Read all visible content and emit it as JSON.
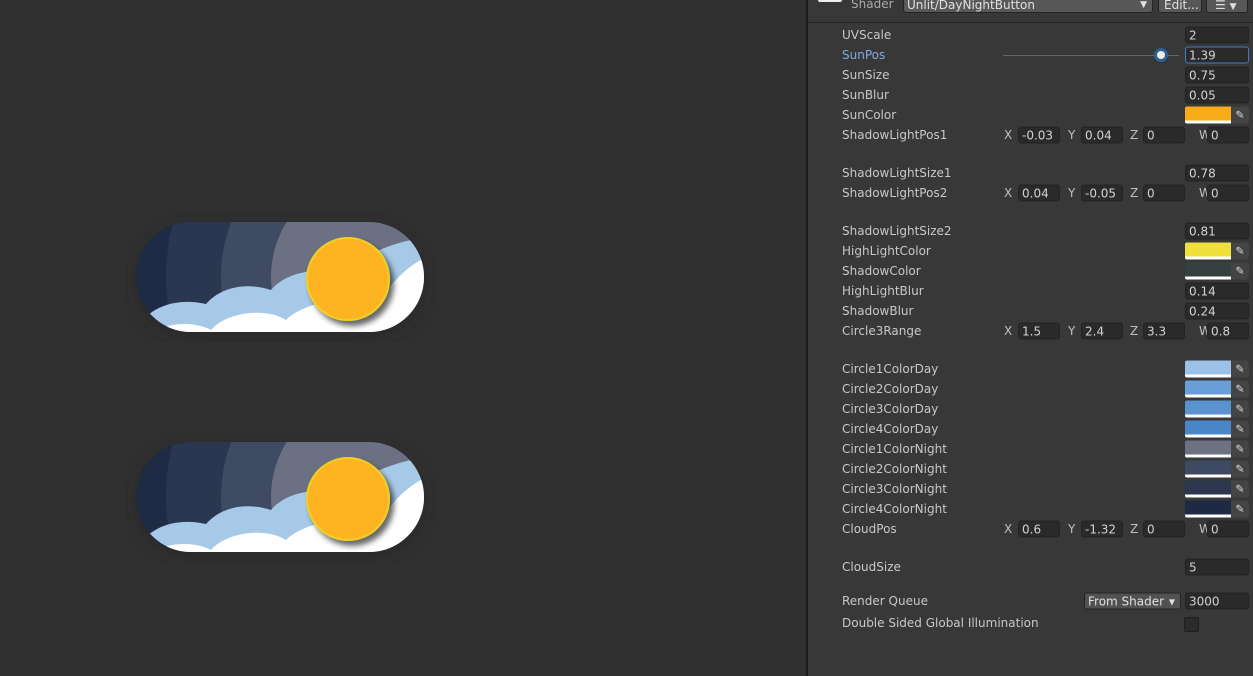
{
  "header": {
    "shader_label": "Shader",
    "shader_value": "Unlit/DayNightButton",
    "edit_label": "Edit...",
    "menu_icon": "list-icon"
  },
  "slider": {
    "value": 1.39,
    "min": 0,
    "max": 1.5
  },
  "rows": [
    {
      "label": "UVScale",
      "type": "float",
      "value": "2"
    },
    {
      "label": "SunPos",
      "type": "slider",
      "value": "1.39",
      "active": true
    },
    {
      "label": "SunSize",
      "type": "float",
      "value": "0.75"
    },
    {
      "label": "SunBlur",
      "type": "float",
      "value": "0.05"
    },
    {
      "label": "SunColor",
      "type": "color",
      "color": "#f8ac18"
    },
    {
      "label": "ShadowLightPos1",
      "type": "vector",
      "x": "-0.03",
      "y": "0.04",
      "z": "0",
      "w": "0"
    },
    {
      "label": "ShadowLightSize1",
      "type": "float",
      "value": "0.78"
    },
    {
      "label": "ShadowLightPos2",
      "type": "vector",
      "x": "0.04",
      "y": "-0.05",
      "z": "0",
      "w": "0"
    },
    {
      "label": "ShadowLightSize2",
      "type": "float",
      "value": "0.81"
    },
    {
      "label": "HighLightColor",
      "type": "color",
      "color": "#f0e03c"
    },
    {
      "label": "ShadowColor",
      "type": "color",
      "color": "#36403f"
    },
    {
      "label": "HighLightBlur",
      "type": "float",
      "value": "0.14"
    },
    {
      "label": "ShadowBlur",
      "type": "float",
      "value": "0.24"
    },
    {
      "label": "Circle3Range",
      "type": "vector",
      "x": "1.5",
      "y": "2.4",
      "z": "3.3",
      "w": "0.8"
    },
    {
      "label": "Circle1ColorDay",
      "type": "color",
      "color": "#9cc0e6"
    },
    {
      "label": "Circle2ColorDay",
      "type": "color",
      "color": "#6a9ed6"
    },
    {
      "label": "Circle3ColorDay",
      "type": "color",
      "color": "#5a92d0"
    },
    {
      "label": "Circle4ColorDay",
      "type": "color",
      "color": "#4a86c6"
    },
    {
      "label": "Circle1ColorNight",
      "type": "color",
      "color": "#6c7284"
    },
    {
      "label": "Circle2ColorNight",
      "type": "color",
      "color": "#3e4a62"
    },
    {
      "label": "Circle3ColorNight",
      "type": "color",
      "color": "#2c374e"
    },
    {
      "label": "Circle4ColorNight",
      "type": "color",
      "color": "#1e2944"
    },
    {
      "label": "CloudPos",
      "type": "vector",
      "x": "0.6",
      "y": "-1.32",
      "z": "0",
      "w": "0"
    },
    {
      "label": "CloudSize",
      "type": "float",
      "value": "5"
    }
  ],
  "render_queue": {
    "label": "Render Queue",
    "mode": "From Shader",
    "value": "3000"
  },
  "gi": {
    "label": "Double Sided Global Illumination",
    "checked": false
  },
  "toggle_colors": {
    "sun": "#fdb324",
    "cloud_back": "#a7c9e8",
    "cloud_front": "#ffffff",
    "bands": [
      "#1f2a45",
      "#2b3650",
      "#3f4b63",
      "#6b7082"
    ]
  }
}
